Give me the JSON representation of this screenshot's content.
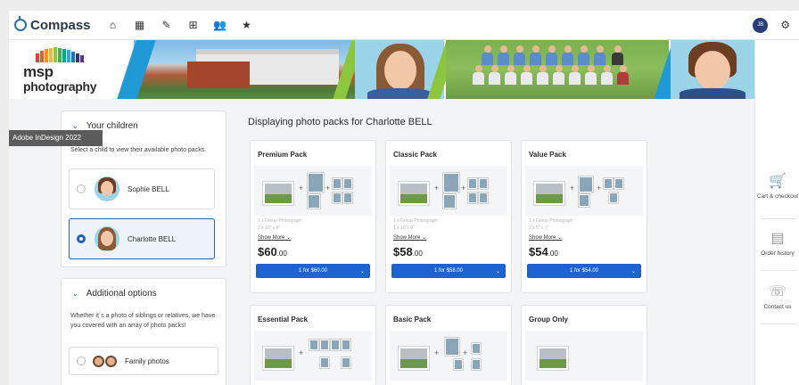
{
  "app": {
    "name": "Compass",
    "user_initials": "JB"
  },
  "nav": [
    {
      "name": "home-icon",
      "glyph": "⌂"
    },
    {
      "name": "calendar-icon",
      "glyph": "▦"
    },
    {
      "name": "pencil-icon",
      "glyph": "✎"
    },
    {
      "name": "grid-icon",
      "glyph": "⊞"
    },
    {
      "name": "people-icon",
      "glyph": "👥"
    },
    {
      "name": "star-icon",
      "glyph": "★"
    }
  ],
  "banner": {
    "brand_line1": "msp",
    "brand_line2": "photography"
  },
  "tooltip": "Adobe InDesign 2022",
  "children_panel": {
    "title": "Your children",
    "description": "Select a child to view their available photo packs.",
    "children": [
      {
        "name": "Sophie BELL",
        "selected": false
      },
      {
        "name": "Charlotte BELL",
        "selected": true
      }
    ]
  },
  "options_panel": {
    "title": "Additional options",
    "description": "Whether it´s a photo of siblings or relatives, we have you covered with an array of photo packs!",
    "family_label": "Family photos"
  },
  "main": {
    "title": "Displaying photo packs for Charlotte BELL",
    "packs": [
      {
        "name": "Premium Pack",
        "line1": "1 x Group Photograph",
        "line2": "2 x 10\" x 8\"",
        "show_more": "Show More",
        "price_main": "$60",
        "price_cents": ".00",
        "button": "1 for $60.00"
      },
      {
        "name": "Classic Pack",
        "line1": "1 x Group Photograph",
        "line2": "1 x 10\"x 8\"",
        "show_more": "Show More",
        "price_main": "$58",
        "price_cents": ".00",
        "button": "1 for $58.00"
      },
      {
        "name": "Value Pack",
        "line1": "1 x Group Photograph",
        "line2": "2 x 5\" x 7\"",
        "show_more": "Show More",
        "price_main": "$54",
        "price_cents": ".00",
        "button": "1 for $54.00"
      },
      {
        "name": "Essential Pack"
      },
      {
        "name": "Basic Pack"
      },
      {
        "name": "Group Only"
      }
    ]
  },
  "rail": [
    {
      "label": "Cart & checkout",
      "icon": "cart-icon"
    },
    {
      "label": "Order history",
      "icon": "receipt-icon"
    },
    {
      "label": "Contact us",
      "icon": "phone-icon"
    }
  ],
  "colors": {
    "accent": "#1f62d1",
    "brand": "#2c6fb7",
    "banner_blue": "#1f9ad6",
    "banner_green": "#8cc63f"
  }
}
